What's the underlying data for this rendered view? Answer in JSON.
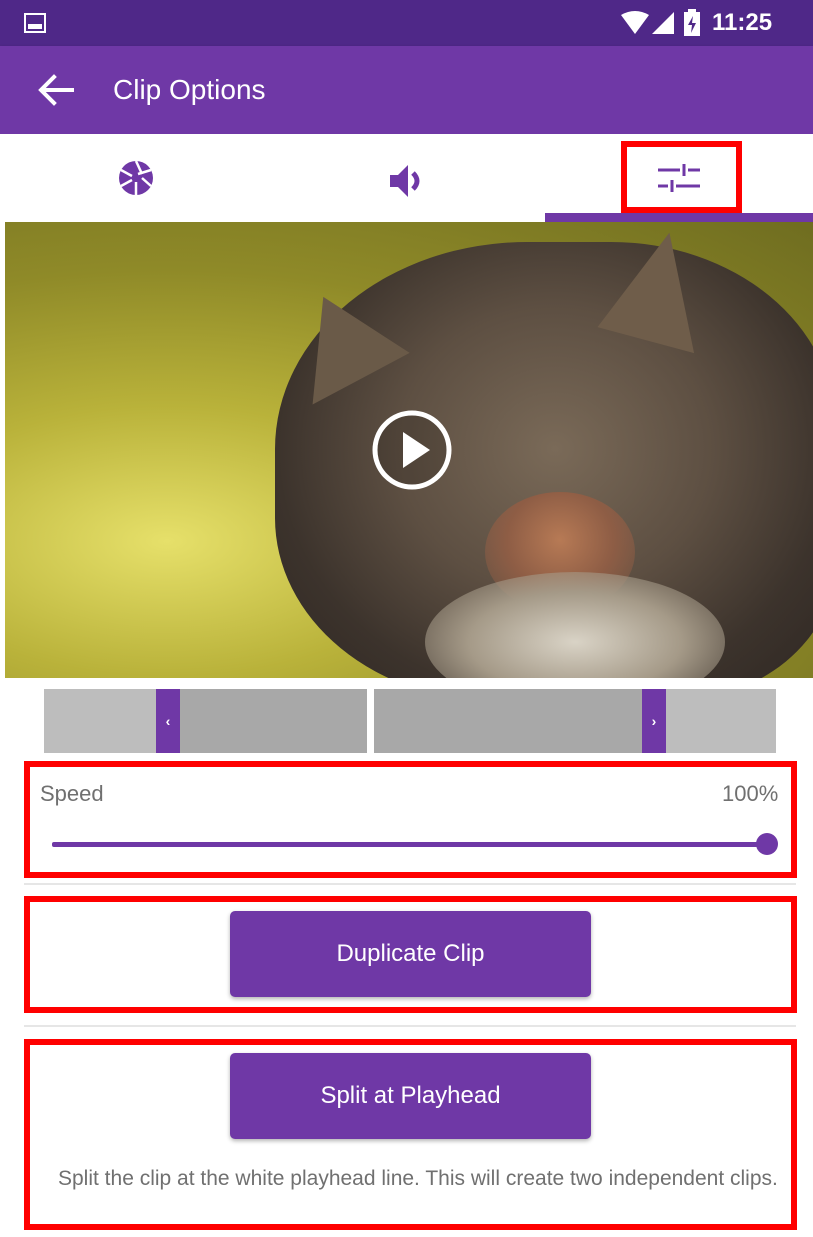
{
  "status_bar": {
    "time": "11:25",
    "icons": [
      "image-icon",
      "wifi-icon",
      "signal-icon",
      "battery-charging-icon"
    ]
  },
  "app_bar": {
    "title": "Clip Options",
    "back_icon": "arrow-left-icon"
  },
  "tabs": [
    {
      "icon": "aperture-icon",
      "selected": false
    },
    {
      "icon": "volume-icon",
      "selected": false
    },
    {
      "icon": "sliders-icon",
      "selected": true
    }
  ],
  "video": {
    "play_icon": "play-icon"
  },
  "timeline": {
    "left_handle_glyph": "‹",
    "right_handle_glyph": "›"
  },
  "speed": {
    "label": "Speed",
    "value": "100%",
    "level_percent": 100
  },
  "duplicate": {
    "label": "Duplicate Clip"
  },
  "split": {
    "label": "Split at Playhead",
    "description": "Split the clip at the white playhead line. This will create two independent clips."
  },
  "colors": {
    "status_bar": "#4f2888",
    "app_bar": "#6f38a6",
    "accent": "#6f38a6",
    "highlight": "#ff0000"
  }
}
